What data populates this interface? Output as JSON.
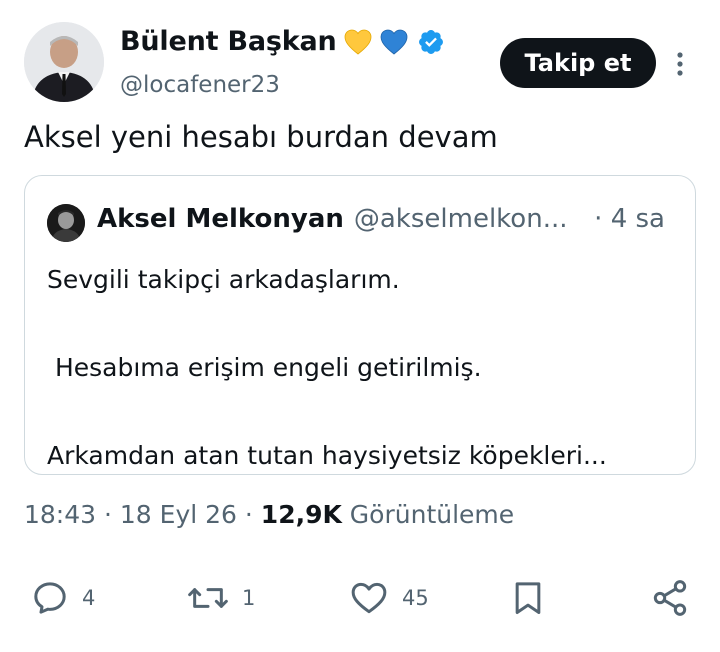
{
  "author": {
    "name": "Bülent Başkan",
    "handle": "@locafener23",
    "emoji": [
      "yellow-heart",
      "blue-heart"
    ],
    "verified": true
  },
  "follow_label": "Takip et",
  "tweet_text": "Aksel yeni hesabı burdan devam",
  "quote": {
    "name": "Aksel Melkonyan",
    "handle": "@akselmelkon...",
    "time": "· 4 sa",
    "lines": [
      "Sevgili takipçi arkadaşlarım.",
      " Hesabıma erişim engeli getirilmiş.",
      "Arkamdan atan tutan haysiyetsiz köpekleri..."
    ]
  },
  "meta": {
    "time": "18:43",
    "sep1": " · ",
    "date": "18 Eyl 26",
    "sep2": " · ",
    "views_count": "12,9K",
    "views_label": " Görüntüleme"
  },
  "actions": {
    "reply_count": "4",
    "retweet_count": "1",
    "like_count": "45"
  },
  "colors": {
    "text": "#0f1419",
    "secondary": "#536471",
    "border": "#cfd9de",
    "verified": "#1d9bf0",
    "button": "#0f1419"
  }
}
